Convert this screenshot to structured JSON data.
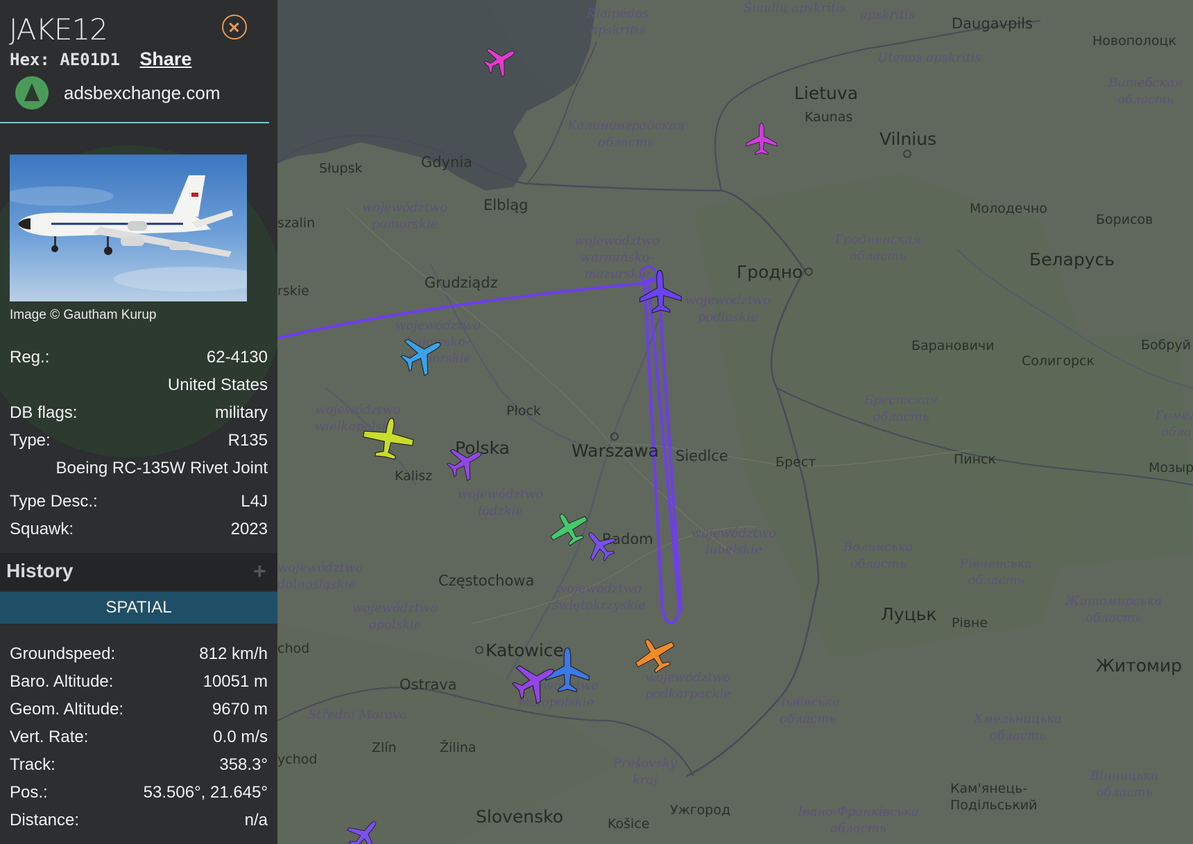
{
  "aircraft": {
    "callsign": "JAKE12",
    "hex_label": "Hex:",
    "hex": "AE01D1",
    "share_label": "Share",
    "source": "adsbexchange.com",
    "photo_credit": "Image © Gautham Kurup"
  },
  "details": {
    "reg_label": "Reg.:",
    "reg": "62-4130",
    "country": "United States",
    "dbflags_label": "DB flags:",
    "dbflags": "military",
    "type_label": "Type:",
    "type": "R135",
    "type_full": "Boeing RC-135W Rivet Joint",
    "typedesc_label": "Type Desc.:",
    "typedesc": "L4J",
    "squawk_label": "Squawk:",
    "squawk": "2023"
  },
  "history": {
    "title": "History",
    "plus": "+",
    "tab": "SPATIAL"
  },
  "spatial": {
    "gs_label": "Groundspeed:",
    "gs": "812 km/h",
    "baro_label": "Baro. Altitude:",
    "baro": "10051 m",
    "geom_label": "Geom. Altitude:",
    "geom": "9670 m",
    "vrate_label": "Vert. Rate:",
    "vrate": "0.0 m/s",
    "track_label": "Track:",
    "track": "358.3°",
    "pos_label": "Pos.:",
    "pos": "53.506°, 21.645°",
    "dist_label": "Distance:",
    "dist": "n/a"
  },
  "map": {
    "cities": {
      "daugavpils": "Daugavpils",
      "novopolotsk": "Новополоцк",
      "lietuva": "Lietuva",
      "kaunas": "Kaunas",
      "vilnius": "Vilnius",
      "slupsk": "Słupsk",
      "gdynia": "Gdynia",
      "elblag": "Elbląg",
      "szalin": "szalin",
      "molodechno": "Молодечно",
      "borisov": "Борисов",
      "belarus": "Беларусь",
      "grudziadz": "Grudziądz",
      "grodno": "Гродно",
      "baranovichi": "Барановичи",
      "soligorsk": "Солигорск",
      "bobruisk": "Бобруй",
      "plock": "Płock",
      "polska": "Polska",
      "warszawa": "Warszawa",
      "siedlce": "Siedlce",
      "brest": "Брест",
      "pinsk": "Пинск",
      "mozyr": "Мозыр",
      "kalisz": "Kalisz",
      "radom": "Radom",
      "czestochowa": "Częstochowa",
      "lutsk": "Луцьк",
      "rivne": "Рівне",
      "katowice": "Katowice",
      "ostrava": "Ostrava",
      "zhytomyr": "Житомир",
      "zlin": "Zlín",
      "zilina": "Žilina",
      "slovensko": "Slovensko",
      "kosice": "Košice",
      "uzhhorod": "Ужгород",
      "kamianets": "Кам'янець-\nПодільський",
      "chod": "chod",
      "ychod": "ychod",
      "rskie": "rskie"
    },
    "regions": {
      "klaipedos": "Klaipėdos\napskritis",
      "siauliu": "Šiaulių apskritis",
      "apskritis": "apskritis",
      "utenos": "Utenos apskritis",
      "vitebsk": "Витебская\nобласть",
      "kaliningrad": "Калининградская\nобласть",
      "pomorskie": "województwo\npomorskie",
      "warminsko": "województwo\nwarmińsko-\nmazurskie",
      "grodnenskaya": "Гродненская\nобласть",
      "podlaskie": "województwo\npodlaskie",
      "kujawsko": "województwo\nkujawsko-\npomorskie",
      "brestskaya": "Брестская\nобласть",
      "gomel": "Гомел\nобла",
      "wielkopolskie": "województwo\nwielkopolskie",
      "lodzkie": "województwo\nłódzkie",
      "lubelskie": "województwo\nlubelskie",
      "volyn": "Волинська\nобласть",
      "rivnenska": "Рівненська\nобласть",
      "zhytomyrska": "Житомирська\nобласть",
      "dolnoslaskie": "województwo\ndolnośląskie",
      "swietokrzyskie": "województwo\nświętokrzyskie",
      "opolskie": "województwo\nopolskie",
      "podkarpackie": "województwo\npodkarpackie",
      "malopolskie": "województwo\nmałopolskie",
      "morava": "Střední Morava",
      "lvivska": "Львівська\nобласть",
      "khmelnytska": "Хмельницька\nобласть",
      "presovsky": "Prešovský\nkraj",
      "vinnytska": "Вінницька\nобласть",
      "ivanofrankivska": "Івано-Франківська\nобласть"
    },
    "colors": {
      "track": "#6e3df0",
      "selected": "#6a43f0",
      "magenta": "#e53ad0",
      "skyblue": "#3aa3e8",
      "yellow": "#c8dc2a",
      "purple": "#9346e6",
      "green": "#45c86e",
      "orange": "#f08a28",
      "blue": "#3d78e8"
    }
  }
}
